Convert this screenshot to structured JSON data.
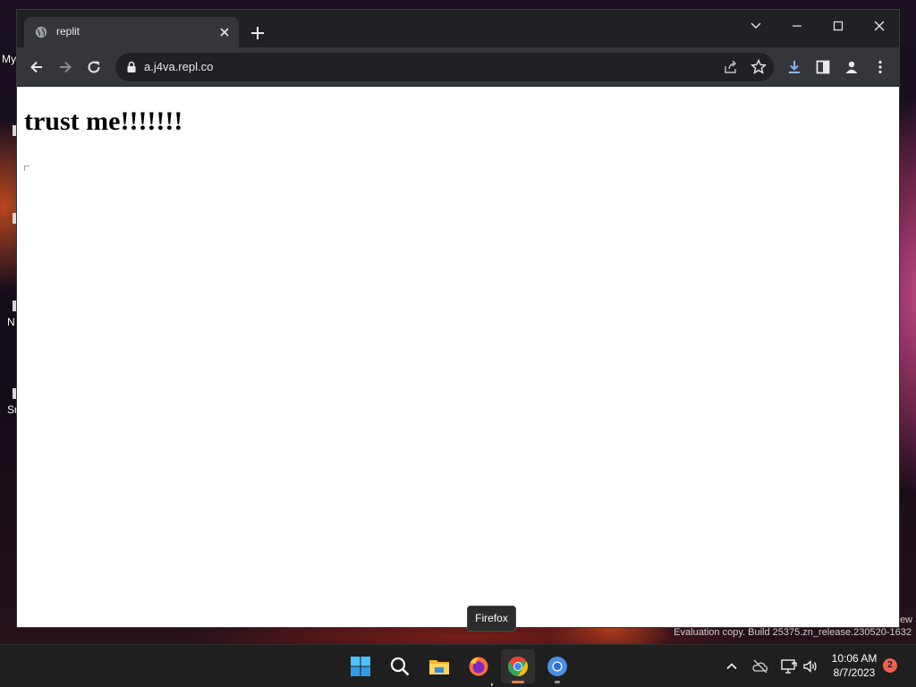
{
  "desktop": {
    "icon_labels": [
      "My",
      "N",
      "Su"
    ]
  },
  "browser": {
    "tab": {
      "title": "replit",
      "favicon": "globe-icon"
    },
    "new_tab_icon": "plus-icon",
    "window_controls": [
      "chevron-down-icon",
      "minimize-icon",
      "maximize-icon",
      "close-icon"
    ],
    "toolbar": {
      "url": "a.j4va.repl.co",
      "icons": [
        "back-arrow-icon",
        "forward-arrow-icon",
        "reload-icon",
        "lock-icon",
        "share-icon",
        "star-icon",
        "download-icon",
        "side-panel-icon",
        "profile-icon",
        "kebab-menu-icon"
      ]
    },
    "page": {
      "heading": "trust me!!!!!!!"
    }
  },
  "tooltip": {
    "text": "Firefox"
  },
  "watermark": {
    "line1": "ew",
    "line2": "Evaluation copy. Build 25375.zn_release.230520-1632"
  },
  "taskbar": {
    "apps": [
      "windows-start-icon",
      "search-icon",
      "file-explorer-icon",
      "firefox-icon",
      "chrome-icon",
      "chrome-icon"
    ],
    "tray": [
      "chevron-up-icon",
      "onedrive-icon",
      "network-icon",
      "volume-icon"
    ],
    "clock": {
      "time": "10:06 AM",
      "date": "8/7/2023"
    },
    "notification_count": "2"
  },
  "colors": {
    "tabstrip": "#202124",
    "toolbar": "#35363a",
    "taskbar": "#1f1f1f",
    "accent": "#e87e4b",
    "badge": "#f0604e"
  }
}
